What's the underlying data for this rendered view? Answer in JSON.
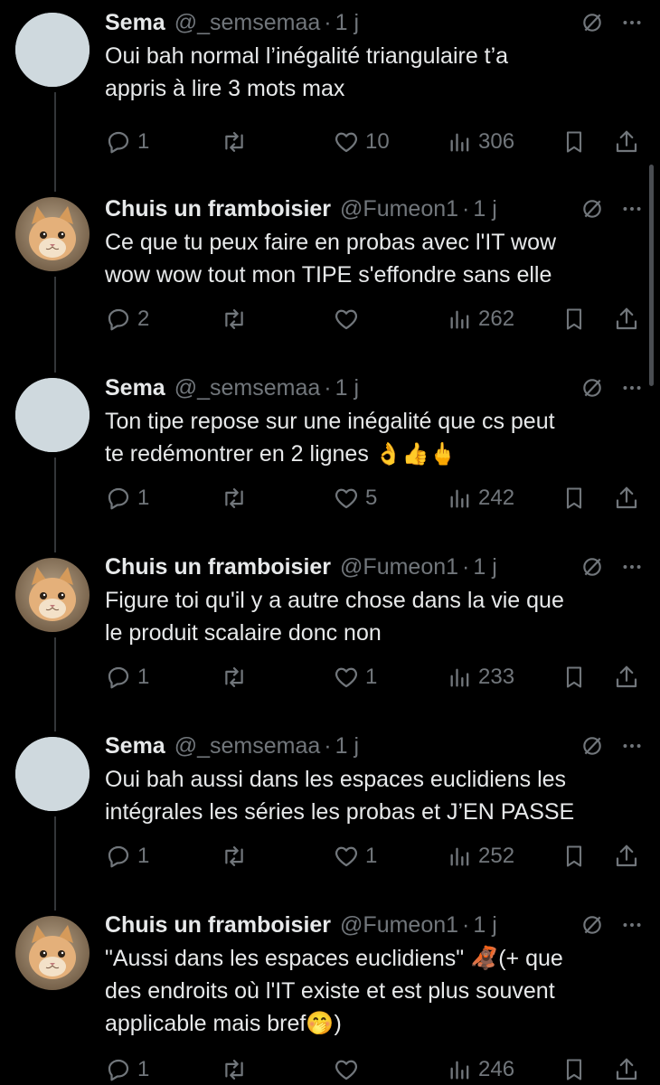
{
  "tweets": [
    {
      "name": "Sema",
      "handle": "@_semsemaa",
      "time": "1 j",
      "avatar": "default",
      "text": "Oui bah normal l’inégalité triangulaire t’a\nappris à lire 3 mots max",
      "emoji": "",
      "replies": "1",
      "retweets": "",
      "likes": "10",
      "views": "306"
    },
    {
      "name": "Chuis un framboisier",
      "handle": "@Fumeon1",
      "time": "1 j",
      "avatar": "cat",
      "text": "Ce que tu peux faire en probas avec l'IT wow\nwow wow tout mon TIPE s'effondre sans elle",
      "emoji": "",
      "replies": "2",
      "retweets": "",
      "likes": "",
      "views": "262"
    },
    {
      "name": "Sema",
      "handle": "@_semsemaa",
      "time": "1 j",
      "avatar": "default",
      "text": "Ton tipe repose sur une inégalité que cs peut\nte redémontrer en 2 lignes ",
      "emoji": "👌👍🖕",
      "replies": "1",
      "retweets": "",
      "likes": "5",
      "views": "242"
    },
    {
      "name": "Chuis un framboisier",
      "handle": "@Fumeon1",
      "time": "1 j",
      "avatar": "cat",
      "text": "Figure toi qu'il y a autre chose dans la vie que\nle produit scalaire donc non",
      "emoji": "",
      "replies": "1",
      "retweets": "",
      "likes": "1",
      "views": "233"
    },
    {
      "name": "Sema",
      "handle": "@_semsemaa",
      "time": "1 j",
      "avatar": "default",
      "text": "Oui bah aussi dans les espaces euclidiens les\nintégrales les séries les probas et J’EN PASSE",
      "emoji": "",
      "replies": "1",
      "retweets": "",
      "likes": "1",
      "views": "252"
    },
    {
      "name": "Chuis un framboisier",
      "handle": "@Fumeon1",
      "time": "1 j",
      "avatar": "cat",
      "text": "\"Aussi dans les espaces euclidiens\" 🦧(+ que\ndes endroits où l'IT existe et est plus souvent\napplicable mais bref🤭)",
      "emoji": "",
      "replies": "1",
      "retweets": "",
      "likes": "",
      "views": "246"
    }
  ],
  "icons": {
    "reply": "reply-icon",
    "retweet": "retweet-icon",
    "like": "heart-icon",
    "views": "views-icon",
    "bookmark": "bookmark-icon",
    "share": "share-icon",
    "grok": "grok-icon",
    "more": "more-icon"
  },
  "colors": {
    "background": "#000000",
    "text": "#e7e9ea",
    "muted": "#71767b",
    "thread_line": "#333639"
  }
}
